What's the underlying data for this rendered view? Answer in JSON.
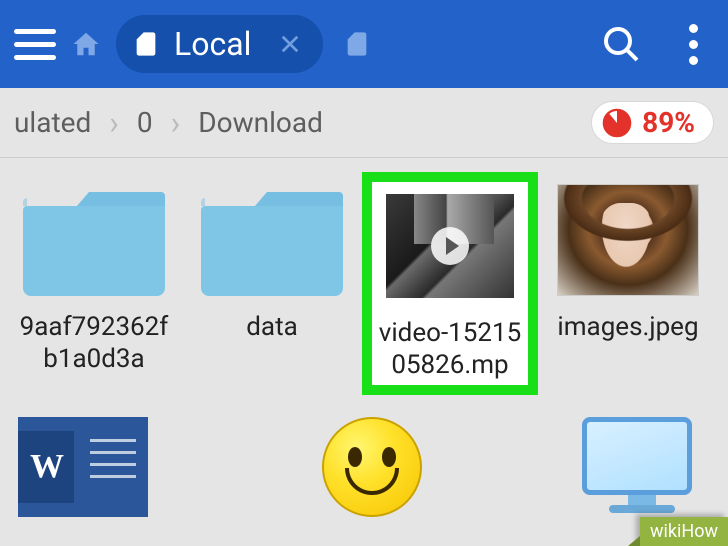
{
  "toolbar": {
    "current_tab_label": "Local"
  },
  "breadcrumb": {
    "items": [
      "ulated",
      "0",
      "Download"
    ],
    "storage_percent": "89%"
  },
  "files": {
    "items": [
      {
        "type": "folder",
        "label": "9aaf792362fb1a0d3a"
      },
      {
        "type": "folder",
        "label": "data"
      },
      {
        "type": "video",
        "label": "video-1521505826.mp",
        "highlighted": true
      },
      {
        "type": "image",
        "label": "images.jpeg"
      }
    ]
  },
  "watermark": "wikiHow"
}
